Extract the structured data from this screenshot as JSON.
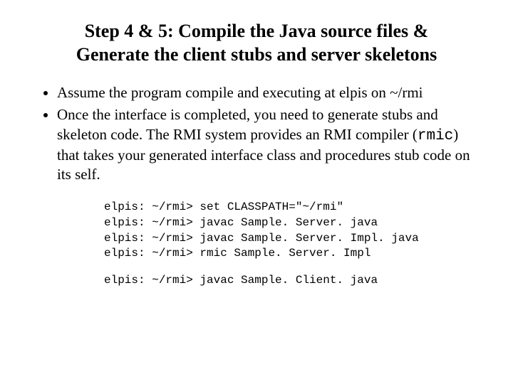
{
  "title_line1": "Step 4 & 5: Compile the Java source files &",
  "title_line2": "Generate the client stubs and server skeletons",
  "bullets": {
    "b1": "Assume the program compile and executing at elpis on ~/rmi",
    "b2_pre": "Once the interface is completed, you need to generate stubs and skeleton code. The RMI system provides an RMI compiler (",
    "b2_code": "rmic",
    "b2_post": ") that takes your generated interface class and procedures stub code on its self."
  },
  "code": {
    "l1": "elpis: ~/rmi> set CLASSPATH=\"~/rmi\"",
    "l2": "elpis: ~/rmi> javac Sample. Server. java",
    "l3": "elpis: ~/rmi> javac Sample. Server. Impl. java",
    "l4": "elpis: ~/rmi> rmic Sample. Server. Impl",
    "l5": "elpis: ~/rmi> javac Sample. Client. java"
  }
}
